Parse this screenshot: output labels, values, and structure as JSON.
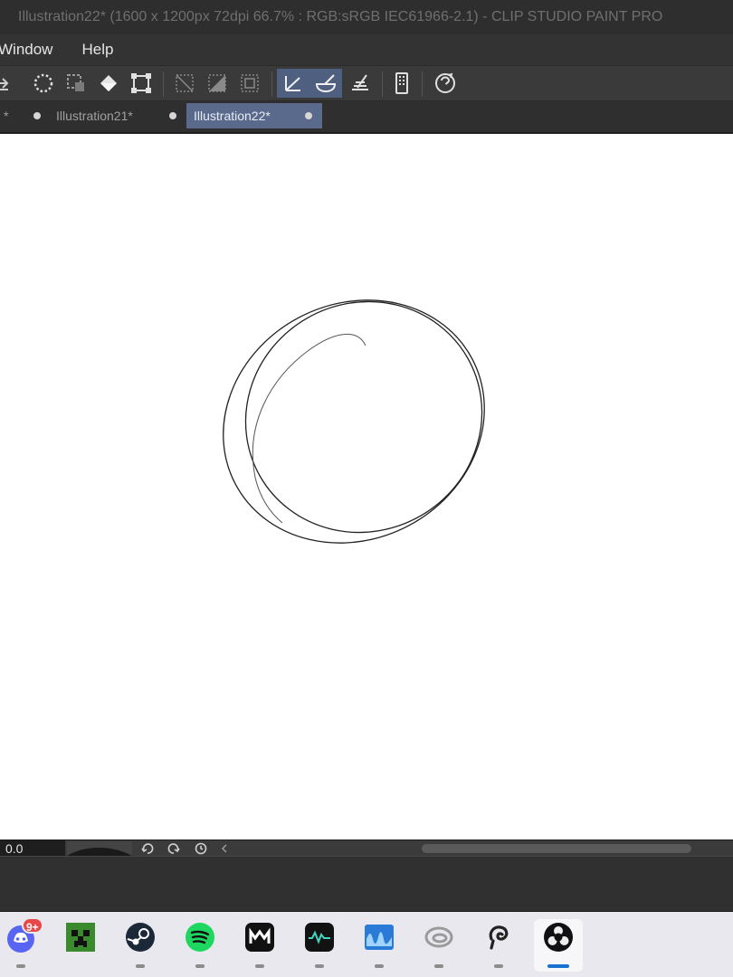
{
  "window": {
    "title": "Illustration22* (1600 x 1200px 72dpi 66.7% : RGB:sRGB IEC61966-2.1)  - CLIP STUDIO PAINT PRO"
  },
  "menu": {
    "items": [
      "Window",
      "Help"
    ]
  },
  "toolbar": {
    "icons": [
      "import-icon",
      "selection-marquee-icon",
      "selection-boundary-icon",
      "fill-icon",
      "transform-icon",
      "deselect-icon",
      "invert-selection-icon",
      "selection-border-icon",
      "snap-ruler-icon",
      "snap-special-ruler-icon",
      "snap-grid-icon",
      "device-settings-icon",
      "help-icon"
    ]
  },
  "tabs": [
    {
      "label": "*"
    },
    {
      "label": "Illustration21*"
    },
    {
      "label": "Illustration22*",
      "active": true
    }
  ],
  "navigator": {
    "zoom_value": "0.0"
  },
  "taskbar": {
    "apps": [
      {
        "name": "Discord",
        "badge": "9+"
      },
      {
        "name": "Minecraft"
      },
      {
        "name": "Steam"
      },
      {
        "name": "Spotify"
      },
      {
        "name": "Medibang"
      },
      {
        "name": "Vtube"
      },
      {
        "name": "Audacity"
      },
      {
        "name": "Link"
      },
      {
        "name": "Clip Studio"
      },
      {
        "name": "OBS",
        "active": true
      }
    ]
  },
  "colors": {
    "accent": "#5a6a8c",
    "taskbar_active": "#1a73d0",
    "badge": "#e84747"
  }
}
